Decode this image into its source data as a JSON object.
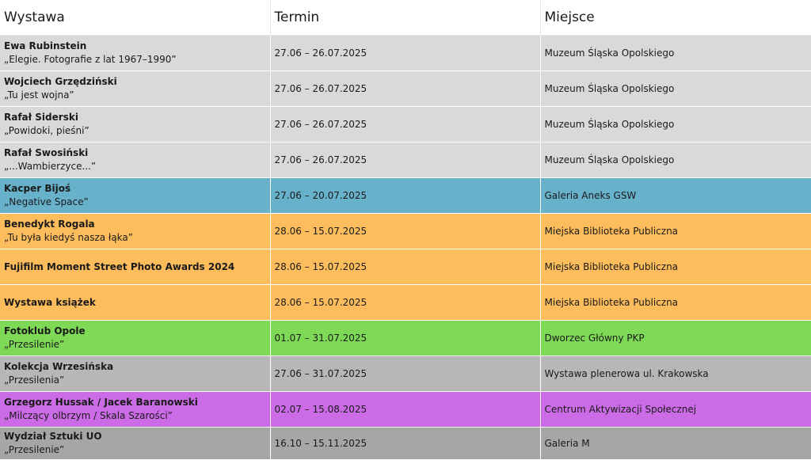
{
  "headers": [
    "Wystawa",
    "Termin",
    "Miejsce"
  ],
  "rows": [
    {
      "artist": "Ewa Rubinstein",
      "title": "„Elegie. Fotografie z lat 1967–1990”",
      "date": "27.06 – 26.07.2025",
      "place": "Muzeum Śląska Opolskiego",
      "color": "#d9d9d9"
    },
    {
      "artist": "Wojciech Grzędziński",
      "title": "„Tu jest wojna”",
      "date": "27.06 – 26.07.2025",
      "place": "Muzeum Śląska Opolskiego",
      "color": "#d9d9d9"
    },
    {
      "artist": "Rafał Siderski",
      "title": "„Powidoki, pieśni”",
      "date": "27.06 – 26.07.2025",
      "place": "Muzeum Śląska Opolskiego",
      "color": "#d9d9d9"
    },
    {
      "artist": "Rafał Swosiński",
      "title": "„...Wambierzyce...”",
      "date": "27.06 – 26.07.2025",
      "place": "Muzeum Śląska Opolskiego",
      "color": "#d9d9d9"
    },
    {
      "artist": "Kacper Bijoś",
      "title": "„Negative Space”",
      "date": "27.06 – 20.07.2025",
      "place": "Galeria Aneks GSW",
      "color": "#67b1cb"
    },
    {
      "artist": "Benedykt Rogala",
      "title": "„Tu była kiedyś nasza łąka”",
      "date": "28.06 – 15.07.2025",
      "place": "Miejska Biblioteka Publiczna",
      "color": "#fdbd5c"
    },
    {
      "artist": "Fujifilm Moment Street Photo Awards 2024",
      "title": "",
      "date": "28.06 – 15.07.2025",
      "place": "Miejska Biblioteka Publiczna",
      "color": "#fdbd5c"
    },
    {
      "artist": "Wystawa książek",
      "title": "",
      "date": "28.06 – 15.07.2025",
      "place": "Miejska Biblioteka Publiczna",
      "color": "#fdbd5c"
    },
    {
      "artist": "Fotoklub Opole",
      "title": "„Przesilenie”",
      "date": "01.07 – 31.07.2025",
      "place": "Dworzec Główny PKP",
      "color": "#7ed957"
    },
    {
      "artist": "Kolekcja Wrzesińska",
      "title": "„Przesilenia”",
      "date": "27.06 – 31.07.2025",
      "place": "Wystawa plenerowa ul. Krakowska",
      "color": "#b7b7b7"
    },
    {
      "artist": "Grzegorz Hussak / Jacek Baranowski",
      "title": "„Milczący olbrzym / Skala Szarości”",
      "date": "02.07 – 15.08.2025",
      "place": "Centrum Aktywizacji Społecznej",
      "color": "#cb6ce6"
    },
    {
      "artist": "Wydział Sztuki UO",
      "title": "„Przesilenie”",
      "date": "16.10 – 15.11.2025",
      "place": "Galeria M",
      "color": "#a6a6a6"
    }
  ]
}
